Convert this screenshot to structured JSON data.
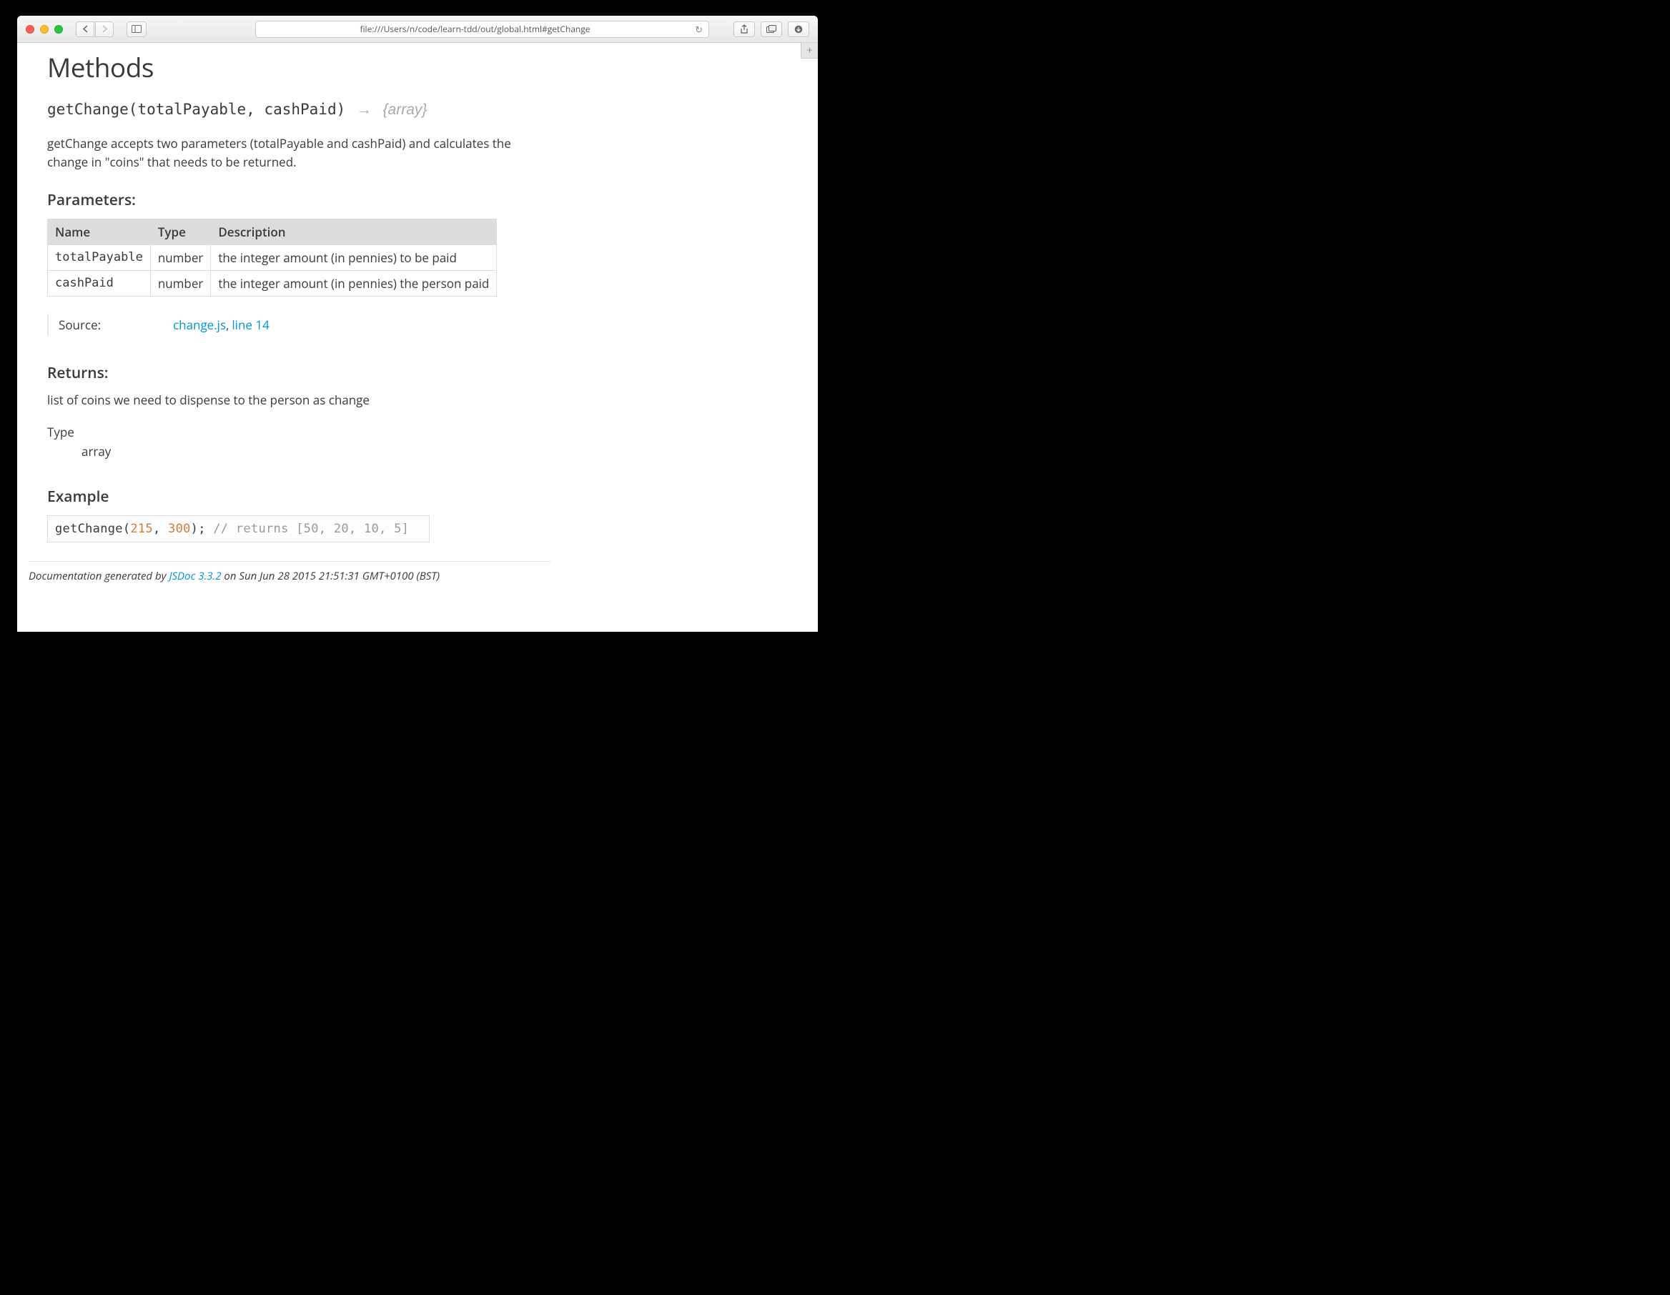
{
  "browser": {
    "url": "file:///Users/n/code/learn-tdd/out/global.html#getChange"
  },
  "page": {
    "heading": "Methods",
    "signature": {
      "name": "getChange",
      "params": "(totalPayable, cashPaid)",
      "returnType": "{array}"
    },
    "description": "getChange accepts two parameters (totalPayable and cashPaid) and calculates the change in \"coins\" that needs to be returned.",
    "parameters": {
      "heading": "Parameters:",
      "columns": {
        "name": "Name",
        "type": "Type",
        "desc": "Description"
      },
      "rows": [
        {
          "name": "totalPayable",
          "type": "number",
          "desc": "the integer amount (in pennies) to be paid"
        },
        {
          "name": "cashPaid",
          "type": "number",
          "desc": "the integer amount (in pennies) the person paid"
        }
      ]
    },
    "source": {
      "label": "Source:",
      "file": "change.js",
      "sep": ", ",
      "line": "line 14"
    },
    "returns": {
      "heading": "Returns:",
      "desc": "list of coins we need to dispense to the person as change",
      "typeLabel": "Type",
      "typeValue": "array"
    },
    "example": {
      "heading": "Example",
      "code": {
        "prefix": "getChange(",
        "n1": "215",
        "sep": ", ",
        "n2": "300",
        "suffix": "); ",
        "comment": "// returns [50, 20, 10, 5]"
      }
    },
    "footer": {
      "prefix": "Documentation generated by ",
      "link": "JSDoc 3.3.2",
      "suffix": " on Sun Jun 28 2015 21:51:31 GMT+0100 (BST)"
    }
  }
}
